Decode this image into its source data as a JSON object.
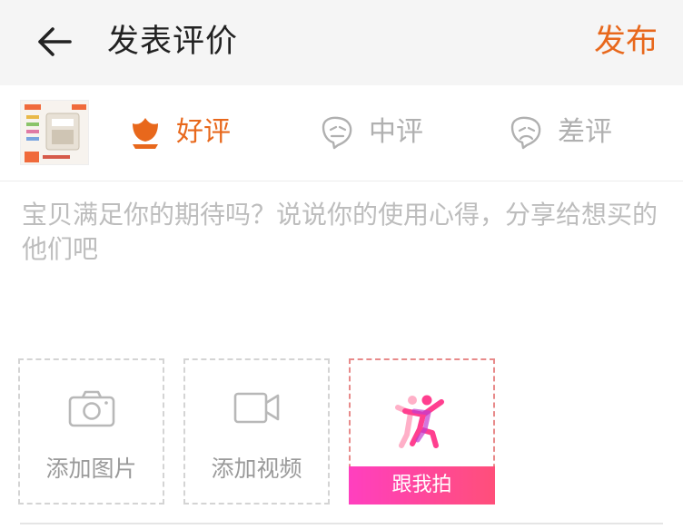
{
  "header": {
    "title": "发表评价",
    "publish_label": "发布"
  },
  "colors": {
    "accent": "#e8681c",
    "inactive": "#b0b0b0",
    "follow_gradient_start": "#ff3fbf",
    "follow_gradient_end": "#ff4f7a"
  },
  "ratings": [
    {
      "label": "好评",
      "selected": true,
      "icon": "flower-icon"
    },
    {
      "label": "中评",
      "selected": false,
      "icon": "neutral-face-icon"
    },
    {
      "label": "差评",
      "selected": false,
      "icon": "sad-face-icon"
    }
  ],
  "review": {
    "placeholder": "宝贝满足你的期待吗？说说你的使用心得，分享给想买的他们吧"
  },
  "media": {
    "add_photo_label": "添加图片",
    "add_video_label": "添加视频",
    "follow_shoot_label": "跟我拍"
  }
}
